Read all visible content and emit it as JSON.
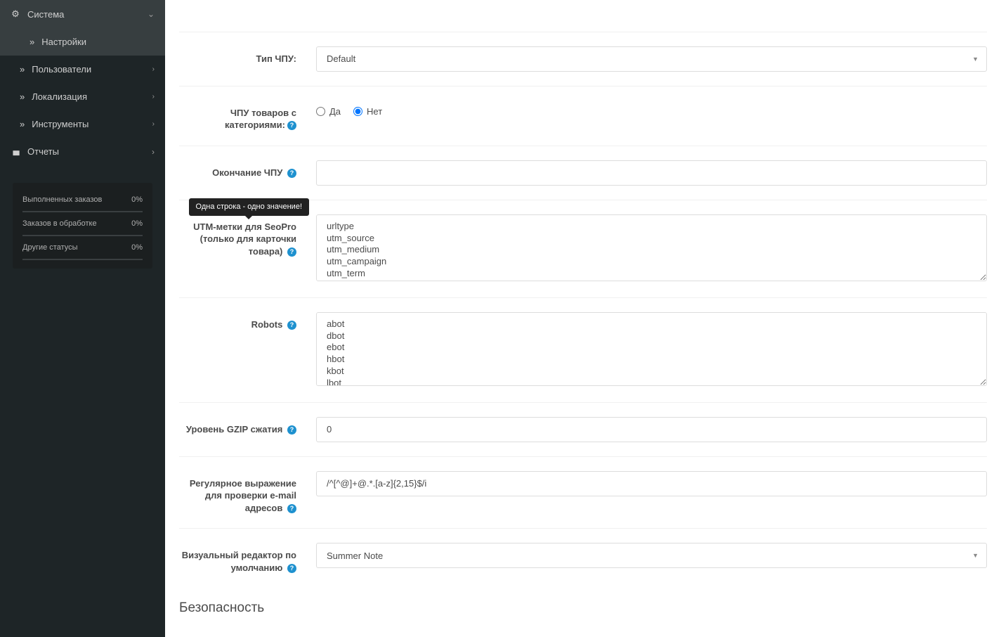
{
  "sidebar": {
    "system": "Система",
    "settings": "Настройки",
    "users": "Пользователи",
    "localization": "Локализация",
    "tools": "Инструменты",
    "reports": "Отчеты"
  },
  "stats": {
    "row1_label": "Выполненных заказов",
    "row1_val": "0%",
    "row2_label": "Заказов в обработке",
    "row2_val": "0%",
    "row3_label": "Другие статусы",
    "row3_val": "0%"
  },
  "form": {
    "yes": "Да",
    "no": "Нет",
    "seo_type_label": "Тип ЧПУ:",
    "seo_type_value": "Default",
    "seo_with_cat_label": "ЧПУ товаров с категориями:",
    "seo_suffix_label": "Окончание ЧПУ",
    "seo_suffix_value": "",
    "utm_tooltip": "Одна строка - одно значение!",
    "utm_label": "UTM-метки для SeoPro (только для карточки товара)",
    "utm_value": "urltype\nutm_source\nutm_medium\nutm_campaign\nutm_term\nutm_content",
    "robots_label": "Robots",
    "robots_value": "abot\ndbot\nebot\nhbot\nkbot\nlbot",
    "gzip_label": "Уровень GZIP сжатия",
    "gzip_value": "0",
    "email_regex_label": "Регулярное выражение для проверки e-mail адресов",
    "email_regex_value": "/^[^@]+@.*.[a-z]{2,15}$/i",
    "editor_label": "Визуальный редактор по умолчанию",
    "editor_value": "Summer Note",
    "security_heading": "Безопасность"
  }
}
